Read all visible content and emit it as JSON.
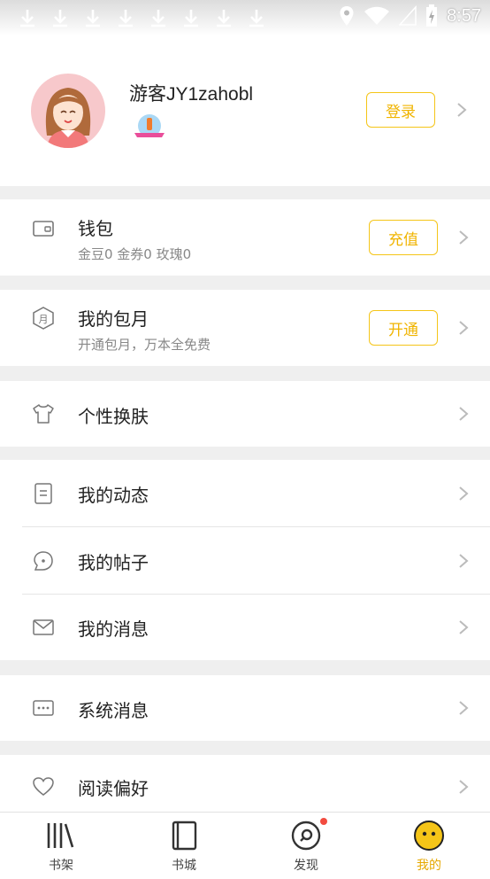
{
  "status_bar": {
    "time": "8:57"
  },
  "profile": {
    "username": "游客JY1zahobl",
    "login_label": "登录"
  },
  "wallet": {
    "title": "钱包",
    "subtitle": "金豆0 金券0 玫瑰0",
    "button": "充值"
  },
  "monthly": {
    "title": "我的包月",
    "subtitle": "开通包月，万本全免费",
    "button": "开通"
  },
  "menu": {
    "skin": "个性换肤",
    "dynamics": "我的动态",
    "posts": "我的帖子",
    "messages": "我的消息",
    "system": "系统消息",
    "preferences": "阅读偏好"
  },
  "tabs": [
    {
      "label": "书架",
      "icon": "bookshelf-icon"
    },
    {
      "label": "书城",
      "icon": "bookstore-icon"
    },
    {
      "label": "发现",
      "icon": "discover-icon"
    },
    {
      "label": "我的",
      "icon": "me-icon"
    }
  ],
  "colors": {
    "accent": "#f5c518",
    "badge_dot": "#f24b3f"
  }
}
